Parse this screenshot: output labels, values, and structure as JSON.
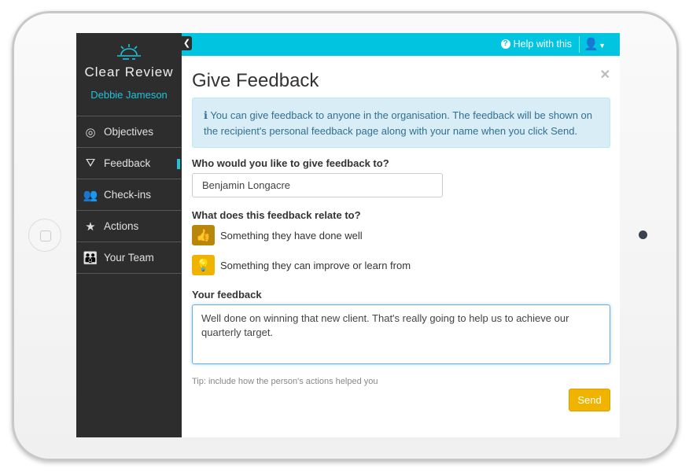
{
  "app": {
    "brand": "Clear Review",
    "user_name": "Debbie Jameson",
    "accent": "#00c4e0"
  },
  "sidebar": {
    "items": [
      {
        "label": "Objectives",
        "icon": "target-icon"
      },
      {
        "label": "Feedback",
        "icon": "feedback-icon",
        "active": true
      },
      {
        "label": "Check-ins",
        "icon": "people-icon"
      },
      {
        "label": "Actions",
        "icon": "star-comment-icon"
      },
      {
        "label": "Your Team",
        "icon": "team-icon"
      }
    ]
  },
  "topbar": {
    "help_label": "Help with this"
  },
  "form": {
    "title": "Give Feedback",
    "info": "You can give feedback to anyone in the organisation. The feedback will be shown on the recipient's personal feedback page along with your name when you click Send.",
    "recipient_label": "Who would you like to give feedback to?",
    "recipient_value": "Benjamin Longacre",
    "relate_label": "What does this feedback relate to?",
    "options": [
      {
        "label": "Something they have done well",
        "icon": "thumbs-up-icon",
        "color": "#b8860b"
      },
      {
        "label": "Something they can improve or learn from",
        "icon": "lightbulb-icon",
        "color": "#f0b400"
      }
    ],
    "feedback_label": "Your feedback",
    "feedback_value": "Well done on winning that new client. That's really going to help us to achieve our quarterly target.",
    "tip": "Tip: include how the person's actions helped you",
    "send_label": "Send"
  }
}
